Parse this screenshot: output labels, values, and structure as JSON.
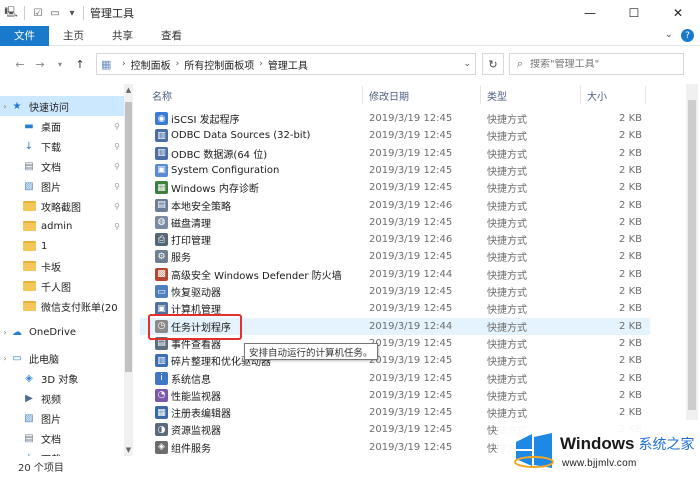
{
  "window": {
    "title": "管理工具",
    "minimize_glyph": "—",
    "maximize_glyph": "☐",
    "close_glyph": "✕"
  },
  "ribbon": {
    "tabs": [
      {
        "label": "文件",
        "active": true
      },
      {
        "label": "主页",
        "active": false
      },
      {
        "label": "共享",
        "active": false
      },
      {
        "label": "查看",
        "active": false
      }
    ],
    "expand_glyph": "⌄",
    "help_glyph": "?"
  },
  "address": {
    "crumbs": [
      "控制面板",
      "所有控制面板项",
      "管理工具"
    ],
    "refresh_glyph": "↻",
    "search_placeholder": "搜索\"管理工具\""
  },
  "nav_pane": {
    "items": [
      {
        "label": "快速访问",
        "icon": "star-icon",
        "selected": true,
        "pinned": false
      },
      {
        "label": "桌面",
        "icon": "desktop-icon",
        "pinned": true
      },
      {
        "label": "下载",
        "icon": "download-icon",
        "pinned": true
      },
      {
        "label": "文档",
        "icon": "document-icon",
        "pinned": true
      },
      {
        "label": "图片",
        "icon": "picture-icon",
        "pinned": true
      },
      {
        "label": "攻略截图",
        "icon": "folder-icon",
        "pinned": true
      },
      {
        "label": "admin",
        "icon": "folder-icon",
        "pinned": true
      },
      {
        "label": "1",
        "icon": "folder-icon",
        "pinned": false
      },
      {
        "label": "卡坂",
        "icon": "folder-icon",
        "pinned": false
      },
      {
        "label": "千人图",
        "icon": "folder-icon",
        "pinned": false
      },
      {
        "label": "微信支付账单(20",
        "icon": "folder-icon",
        "pinned": false
      },
      {
        "label": "OneDrive",
        "icon": "cloud-icon",
        "pinned": false
      },
      {
        "label": "此电脑",
        "icon": "computer-icon",
        "pinned": false
      },
      {
        "label": "3D 对象",
        "icon": "cube-icon",
        "pinned": false
      },
      {
        "label": "视频",
        "icon": "video-icon",
        "pinned": false
      },
      {
        "label": "图片",
        "icon": "picture-icon",
        "pinned": false
      },
      {
        "label": "文档",
        "icon": "document-icon",
        "pinned": false
      },
      {
        "label": "下载",
        "icon": "download-icon",
        "pinned": false
      }
    ]
  },
  "columns": {
    "name": "名称",
    "date": "修改日期",
    "type": "类型",
    "size": "大小"
  },
  "files": [
    {
      "name": "iSCSI 发起程序",
      "date": "2019/3/19 12:45",
      "type": "快捷方式",
      "size": "2 KB",
      "icon": "iscsi-icon",
      "color": "#3a7bd5"
    },
    {
      "name": "ODBC Data Sources (32-bit)",
      "date": "2019/3/19 12:45",
      "type": "快捷方式",
      "size": "2 KB",
      "icon": "odbc-icon",
      "color": "#4a6fa5"
    },
    {
      "name": "ODBC 数据源(64 位)",
      "date": "2019/3/19 12:45",
      "type": "快捷方式",
      "size": "2 KB",
      "icon": "odbc-icon",
      "color": "#4a6fa5"
    },
    {
      "name": "System Configuration",
      "date": "2019/3/19 12:45",
      "type": "快捷方式",
      "size": "2 KB",
      "icon": "config-icon",
      "color": "#5b8bd0"
    },
    {
      "name": "Windows 内存诊断",
      "date": "2019/3/19 12:45",
      "type": "快捷方式",
      "size": "2 KB",
      "icon": "memory-icon",
      "color": "#3f7f3f"
    },
    {
      "name": "本地安全策略",
      "date": "2019/3/19 12:46",
      "type": "快捷方式",
      "size": "2 KB",
      "icon": "policy-icon",
      "color": "#6b7d99"
    },
    {
      "name": "磁盘清理",
      "date": "2019/3/19 12:45",
      "type": "快捷方式",
      "size": "2 KB",
      "icon": "disk-icon",
      "color": "#7a8aa0"
    },
    {
      "name": "打印管理",
      "date": "2019/3/19 12:46",
      "type": "快捷方式",
      "size": "2 KB",
      "icon": "printer-icon",
      "color": "#556677"
    },
    {
      "name": "服务",
      "date": "2019/3/19 12:45",
      "type": "快捷方式",
      "size": "2 KB",
      "icon": "gear-icon",
      "color": "#6f7f8f"
    },
    {
      "name": "高级安全 Windows Defender 防火墙",
      "date": "2019/3/19 12:44",
      "type": "快捷方式",
      "size": "2 KB",
      "icon": "firewall-icon",
      "color": "#b5462f"
    },
    {
      "name": "恢复驱动器",
      "date": "2019/3/19 12:45",
      "type": "快捷方式",
      "size": "2 KB",
      "icon": "drive-icon",
      "color": "#4f7fbf"
    },
    {
      "name": "计算机管理",
      "date": "2019/3/19 12:45",
      "type": "快捷方式",
      "size": "2 KB",
      "icon": "computer-icon",
      "color": "#4f6f9f"
    },
    {
      "name": "任务计划程序",
      "date": "2019/3/19 12:44",
      "type": "快捷方式",
      "size": "2 KB",
      "icon": "clock-icon",
      "color": "#8a8a8a",
      "highlight": true
    },
    {
      "name": "事件查看器",
      "date": "2019/3/19 12:45",
      "type": "快捷方式",
      "size": "2 KB",
      "icon": "event-icon",
      "color": "#5f6f7f"
    },
    {
      "name": "碎片整理和优化驱动器",
      "date": "2019/3/19 12:45",
      "type": "快捷方式",
      "size": "2 KB",
      "icon": "defrag-icon",
      "color": "#3d6fb6"
    },
    {
      "name": "系统信息",
      "date": "2019/3/19 12:45",
      "type": "快捷方式",
      "size": "2 KB",
      "icon": "info-icon",
      "color": "#3f77c4"
    },
    {
      "name": "性能监视器",
      "date": "2019/3/19 12:45",
      "type": "快捷方式",
      "size": "2 KB",
      "icon": "perf-icon",
      "color": "#7a5aa8"
    },
    {
      "name": "注册表编辑器",
      "date": "2019/3/19 12:45",
      "type": "快捷方式",
      "size": "2 KB",
      "icon": "registry-icon",
      "color": "#3c6aa6"
    },
    {
      "name": "资源监视器",
      "date": "2019/3/19 12:45",
      "type": "快捷方式",
      "size": "2 KB",
      "icon": "resource-icon",
      "color": "#5b6b7b"
    },
    {
      "name": "组件服务",
      "date": "2019/3/19 12:45",
      "type": "快捷方式",
      "size": "2 KB",
      "icon": "component-icon",
      "color": "#6d6d6d"
    }
  ],
  "tooltip": "安排自动运行的计算机任务。",
  "status": {
    "count": "20 个项目"
  },
  "watermark": {
    "brand": "Windows",
    "brand_cn": "系统之家",
    "url": "www.bjjmlv.com"
  }
}
